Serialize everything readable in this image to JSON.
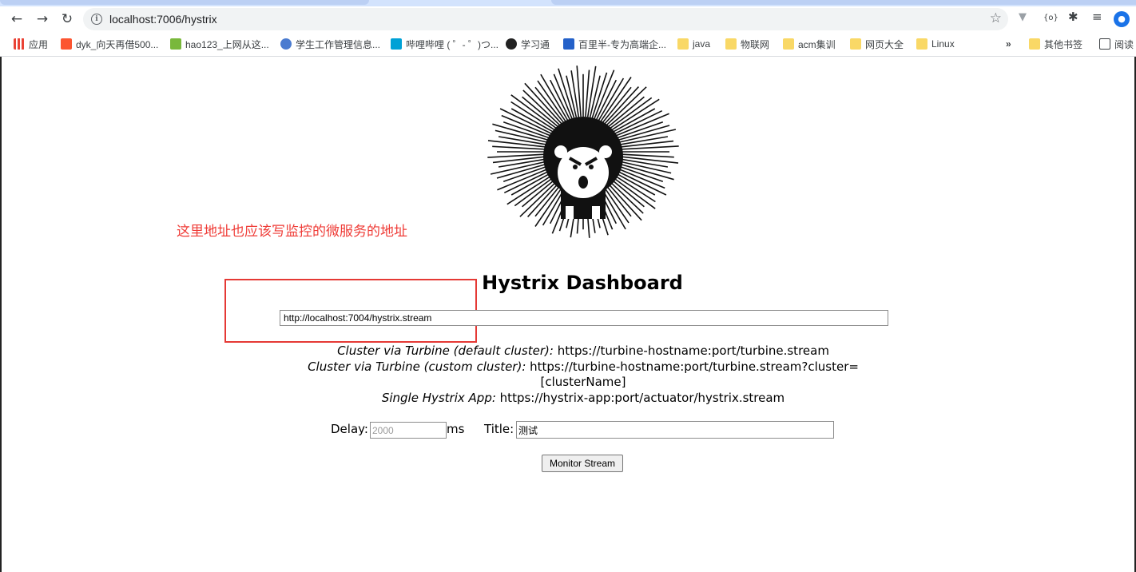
{
  "browser": {
    "url": "localhost:7006/hystrix",
    "bookmarks": [
      {
        "label": "应用"
      },
      {
        "label": "dyk_向天再借500..."
      },
      {
        "label": "hao123_上网从这..."
      },
      {
        "label": "学生工作管理信息..."
      },
      {
        "label": "哔哩哔哩 ( ゜- ゜)つ..."
      },
      {
        "label": "学习通"
      },
      {
        "label": "百里半-专为高端企..."
      },
      {
        "label": "java"
      },
      {
        "label": "物联网"
      },
      {
        "label": "acm集训"
      },
      {
        "label": "网页大全"
      },
      {
        "label": "Linux"
      },
      {
        "label": "其他书签"
      },
      {
        "label": "阅读"
      }
    ],
    "overflow_label": "»"
  },
  "annotation": {
    "text": "这里地址也应该写监控的微服务的地址",
    "color": "#ef3b36"
  },
  "dashboard": {
    "title": "Hystrix Dashboard",
    "stream_value": "http://localhost:7004/hystrix.stream",
    "examples": [
      {
        "label": "Cluster via Turbine (default cluster):",
        "value": " https://turbine-hostname:port/turbine.stream"
      },
      {
        "label": "Cluster via Turbine (custom cluster):",
        "value": " https://turbine-hostname:port/turbine.stream?cluster=[clusterName]"
      },
      {
        "label": "Single Hystrix App:",
        "value": " https://hystrix-app:port/actuator/hystrix.stream"
      }
    ],
    "delay_label": "Delay:",
    "delay_placeholder": "2000",
    "delay_unit": "ms",
    "title_label": "Title:",
    "title_value": "测试",
    "monitor_button": "Monitor Stream"
  }
}
